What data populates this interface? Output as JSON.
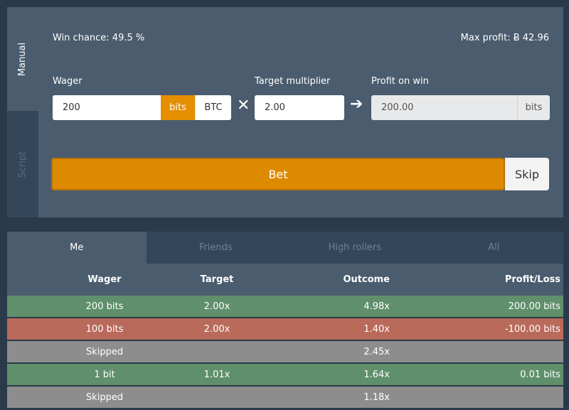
{
  "sidebar": {
    "manual_tab": "Manual",
    "script_tab": "Script"
  },
  "stats": {
    "win_chance": "Win chance: 49.5 %",
    "max_profit": "Max profit: Ƀ 42.96"
  },
  "form": {
    "wager_label": "Wager",
    "wager_value": "200",
    "unit_bits": "bits",
    "unit_btc": "BTC",
    "target_label": "Target multiplier",
    "target_value": "2.00",
    "profit_label": "Profit on win",
    "profit_value": "200.00",
    "profit_unit": "bits"
  },
  "buttons": {
    "bet": "Bet",
    "skip": "Skip"
  },
  "history": {
    "tabs": [
      "Me",
      "Friends",
      "High rollers",
      "All"
    ],
    "columns": [
      "Wager",
      "Target",
      "Outcome",
      "Profit/Loss"
    ],
    "rows": [
      {
        "wager": "200 bits",
        "target": "2.00x",
        "outcome": "4.98x",
        "profit": "200.00 bits",
        "status": "win"
      },
      {
        "wager": "100 bits",
        "target": "2.00x",
        "outcome": "1.40x",
        "profit": "-100.00 bits",
        "status": "lose"
      },
      {
        "wager": "Skipped",
        "target": "",
        "outcome": "2.45x",
        "profit": "",
        "status": "skip"
      },
      {
        "wager": "1 bit",
        "target": "1.01x",
        "outcome": "1.64x",
        "profit": "0.01 bits",
        "status": "win"
      },
      {
        "wager": "Skipped",
        "target": "",
        "outcome": "1.18x",
        "profit": "",
        "status": "skip"
      }
    ]
  },
  "colors": {
    "accent": "#de8a00",
    "win": "#5f8f6b",
    "lose": "#b96a5b",
    "skip": "#8d8d8d",
    "panel": "#4a5c6e"
  }
}
